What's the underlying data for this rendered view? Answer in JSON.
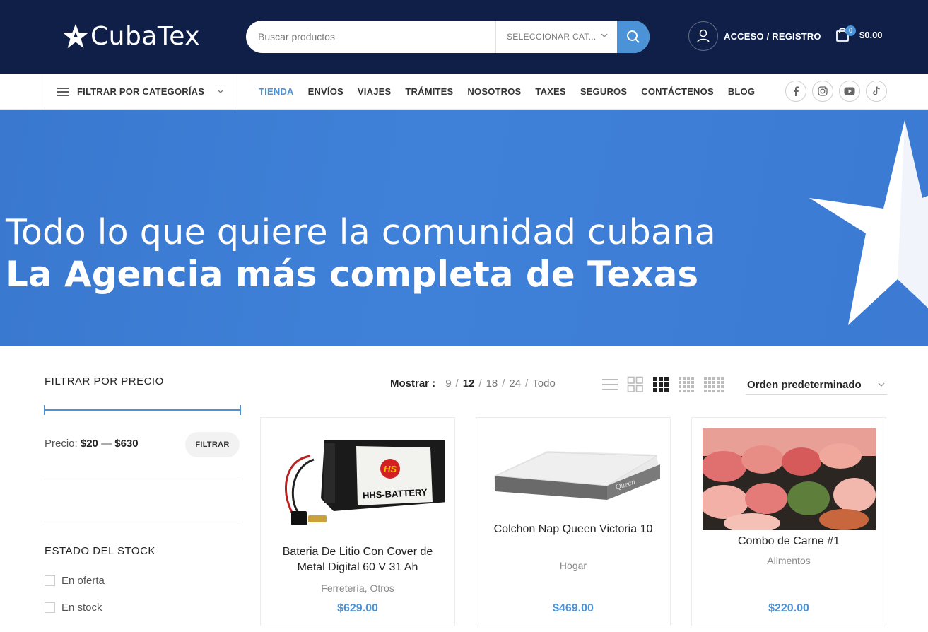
{
  "header": {
    "logo_text": "CubaTex",
    "search_placeholder": "Buscar productos",
    "category_select": "SELECCIONAR CAT...",
    "account_label": "ACCESO / REGISTRO",
    "cart_count": "0",
    "cart_total": "$0.00"
  },
  "nav": {
    "category_filter": "FILTRAR POR CATEGORÍAS",
    "items": [
      {
        "label": "TIENDA"
      },
      {
        "label": "ENVÍOS"
      },
      {
        "label": "VIAJES"
      },
      {
        "label": "TRÁMITES"
      },
      {
        "label": "NOSOTROS"
      },
      {
        "label": "TAXES"
      },
      {
        "label": "SEGUROS"
      },
      {
        "label": "CONTÁCTENOS"
      },
      {
        "label": "BLOG"
      }
    ],
    "social_icons": [
      "facebook-icon",
      "instagram-icon",
      "youtube-icon",
      "tiktok-icon"
    ]
  },
  "hero": {
    "line1": "Todo lo que quiere la comunidad cubana",
    "line2": "La Agencia más completa de Texas"
  },
  "sidebar": {
    "price_title": "FILTRAR POR PRECIO",
    "price_label": "Precio:",
    "price_min": "$20",
    "price_dash": "—",
    "price_max": "$630",
    "filter_button": "FILTRAR",
    "stock_title": "ESTADO DEL STOCK",
    "stock_options": [
      "En oferta",
      "En stock"
    ]
  },
  "toolbar": {
    "show_label": "Mostrar :",
    "show_options": [
      "9",
      "12",
      "18",
      "24",
      "Todo"
    ],
    "show_selected": "12",
    "sort_label": "Orden predeterminado"
  },
  "products": [
    {
      "name": "Bateria De Litio Con Cover de Metal Digital 60 V 31 Ah",
      "category": "Ferretería, Otros",
      "price": "$629.00",
      "image_text": "HHS-BATTERY",
      "logo_text": "HS"
    },
    {
      "name": "Colchon Nap Queen Victoria 10",
      "category": "Hogar",
      "price": "$469.00",
      "image_text": "Queen"
    },
    {
      "name": "Combo de Carne #1",
      "category": "Alimentos",
      "price": "$220.00"
    }
  ],
  "colors": {
    "header_bg": "#0f1f47",
    "accent": "#4b92d6",
    "hero_bg": "#3f81d9"
  }
}
